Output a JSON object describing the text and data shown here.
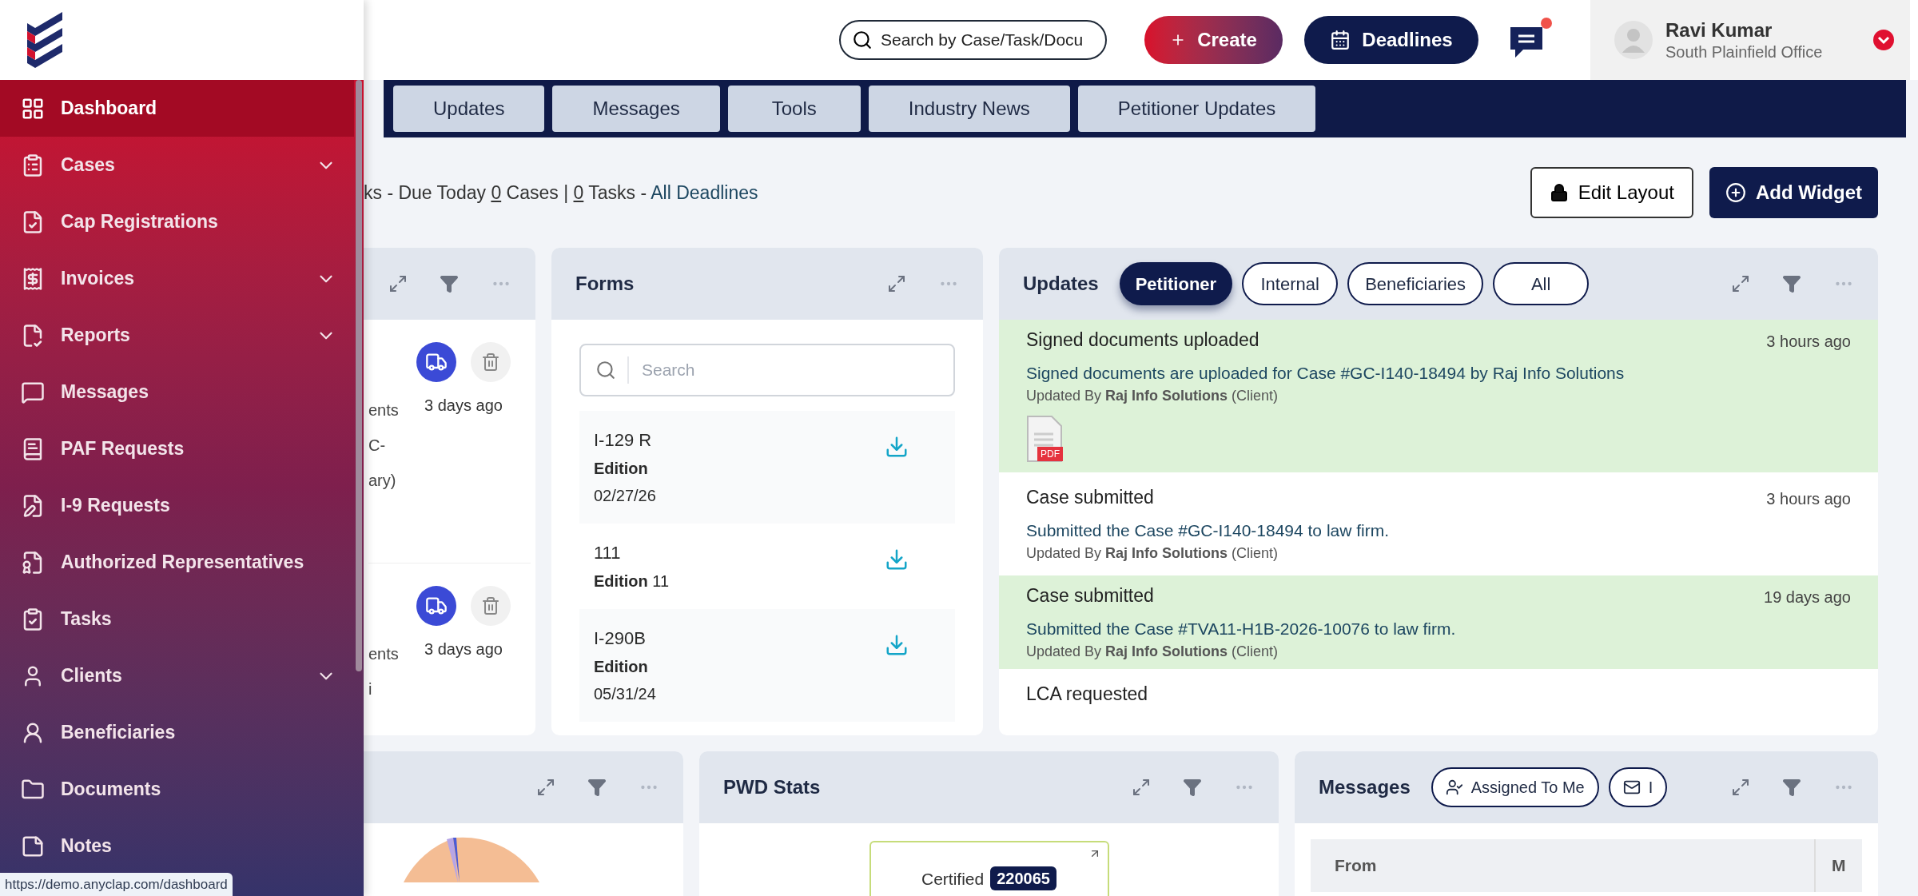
{
  "header": {
    "search": {
      "placeholder": "Search by Case/Task/Docu"
    },
    "create_button": "Create",
    "deadlines_button": "Deadlines",
    "chat_unread": true,
    "user": {
      "name": "Ravi Kumar",
      "office": "South Plainfield Office"
    }
  },
  "sidebar": {
    "items": [
      {
        "label": "Dashboard",
        "selected": true,
        "expandable": false
      },
      {
        "label": "Cases",
        "selected": false,
        "expandable": true
      },
      {
        "label": "Cap Registrations",
        "selected": false,
        "expandable": false
      },
      {
        "label": "Invoices",
        "selected": false,
        "expandable": true
      },
      {
        "label": "Reports",
        "selected": false,
        "expandable": true
      },
      {
        "label": "Messages",
        "selected": false,
        "expandable": false
      },
      {
        "label": "PAF Requests",
        "selected": false,
        "expandable": false
      },
      {
        "label": "I-9 Requests",
        "selected": false,
        "expandable": false
      },
      {
        "label": "Authorized Representatives",
        "selected": false,
        "expandable": false
      },
      {
        "label": "Tasks",
        "selected": false,
        "expandable": false
      },
      {
        "label": "Clients",
        "selected": false,
        "expandable": true
      },
      {
        "label": "Beneficiaries",
        "selected": false,
        "expandable": false
      },
      {
        "label": "Documents",
        "selected": false,
        "expandable": false
      },
      {
        "label": "Notes",
        "selected": false,
        "expandable": false
      }
    ]
  },
  "status_link": "https://demo.anyclap.com/dashboard",
  "nav_tabs": [
    "Updates",
    "Messages",
    "Tools",
    "Industry News",
    "Petitioner Updates"
  ],
  "summary": {
    "prefix": "ks - Due Today",
    "cases_count": "0",
    "cases_label": "Cases |",
    "tasks_count": "0",
    "tasks_label": "Tasks -",
    "link": "All Deadlines"
  },
  "toolbar": {
    "edit_layout": "Edit Layout",
    "add_widget": "Add Widget"
  },
  "cut_widget": {
    "items": [
      {
        "time": "3 days ago",
        "fragments": [
          "ents",
          "C-",
          "ary)"
        ]
      },
      {
        "time": "3 days ago",
        "fragments": [
          "ents",
          "i"
        ]
      }
    ]
  },
  "forms_widget": {
    "title": "Forms",
    "search": {
      "placeholder": "Search"
    },
    "forms": [
      {
        "name": "I-129 R",
        "edition_label": "Edition",
        "edition": "02/27/26",
        "kind": "date"
      },
      {
        "name": "111",
        "edition_label": "Edition",
        "edition": "11",
        "kind": "number"
      },
      {
        "name": "I-290B",
        "edition_label": "Edition",
        "edition": "05/31/24",
        "kind": "date"
      }
    ]
  },
  "updates_widget": {
    "title": "Updates",
    "filters": [
      {
        "label": "Petitioner",
        "selected": true
      },
      {
        "label": "Internal",
        "selected": false
      },
      {
        "label": "Beneficiaries",
        "selected": false
      },
      {
        "label": "All",
        "selected": false
      }
    ],
    "items": [
      {
        "title": "Signed documents uploaded",
        "time": "3 hours ago",
        "body": "Signed documents are uploaded for Case #GC-I140-18494 by Raj Info Solutions",
        "updated_by": "Updated By **Raj Info Solutions** (Client)",
        "highlighted": true,
        "attachment": "PDF"
      },
      {
        "title": "Case submitted",
        "time": "3 hours ago",
        "body": "Submitted the Case #GC-I140-18494 to law firm.",
        "updated_by": "Updated By **Raj Info Solutions** (Client)",
        "highlighted": false
      },
      {
        "title": "Case submitted",
        "time": "19 days ago",
        "body": "Submitted the Case #TVA11-H1B-2026-10076 to law firm.",
        "updated_by": "Updated By **Raj Info Solutions** (Client)",
        "highlighted": true
      },
      {
        "title": "LCA requested",
        "highlighted": false
      }
    ]
  },
  "pwd_widget": {
    "title": "PWD Stats",
    "stat": {
      "label": "Certified",
      "value": "220065"
    }
  },
  "messages_widget": {
    "title": "Messages",
    "filters": [
      "Assigned To Me",
      "I"
    ],
    "columns": [
      "From",
      "M"
    ]
  }
}
